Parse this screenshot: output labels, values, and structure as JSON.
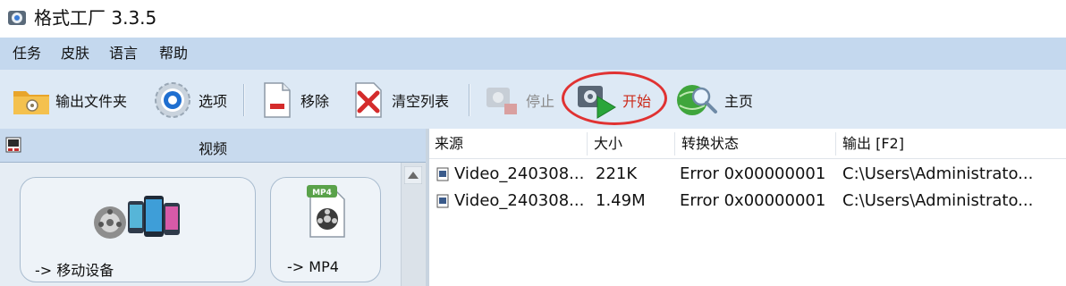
{
  "window": {
    "title": "格式工厂 3.3.5"
  },
  "menu": {
    "items": [
      "任务",
      "皮肤",
      "语言",
      "帮助"
    ]
  },
  "toolbar": {
    "output_folder": "输出文件夹",
    "options": "选项",
    "remove": "移除",
    "clear_list": "清空列表",
    "stop": "停止",
    "start": "开始",
    "home": "主页"
  },
  "left_panel": {
    "title": "视频",
    "tiles": [
      {
        "label": "-> 移动设备"
      },
      {
        "label": "-> MP4",
        "badge": "MP4"
      }
    ]
  },
  "file_list": {
    "columns": [
      "来源",
      "大小",
      "转换状态",
      "输出 [F2]"
    ],
    "rows": [
      {
        "source": "Video_240308...",
        "size": "221K",
        "status": "Error 0x00000001",
        "output": "C:\\Users\\Administrato..."
      },
      {
        "source": "Video_240308...",
        "size": "1.49M",
        "status": "Error 0x00000001",
        "output": "C:\\Users\\Administrato..."
      }
    ]
  },
  "colors": {
    "menubar": "#c4d8ee",
    "toolbar": "#dde9f5",
    "highlight": "#e03232",
    "start_text": "#cc2a1a"
  }
}
